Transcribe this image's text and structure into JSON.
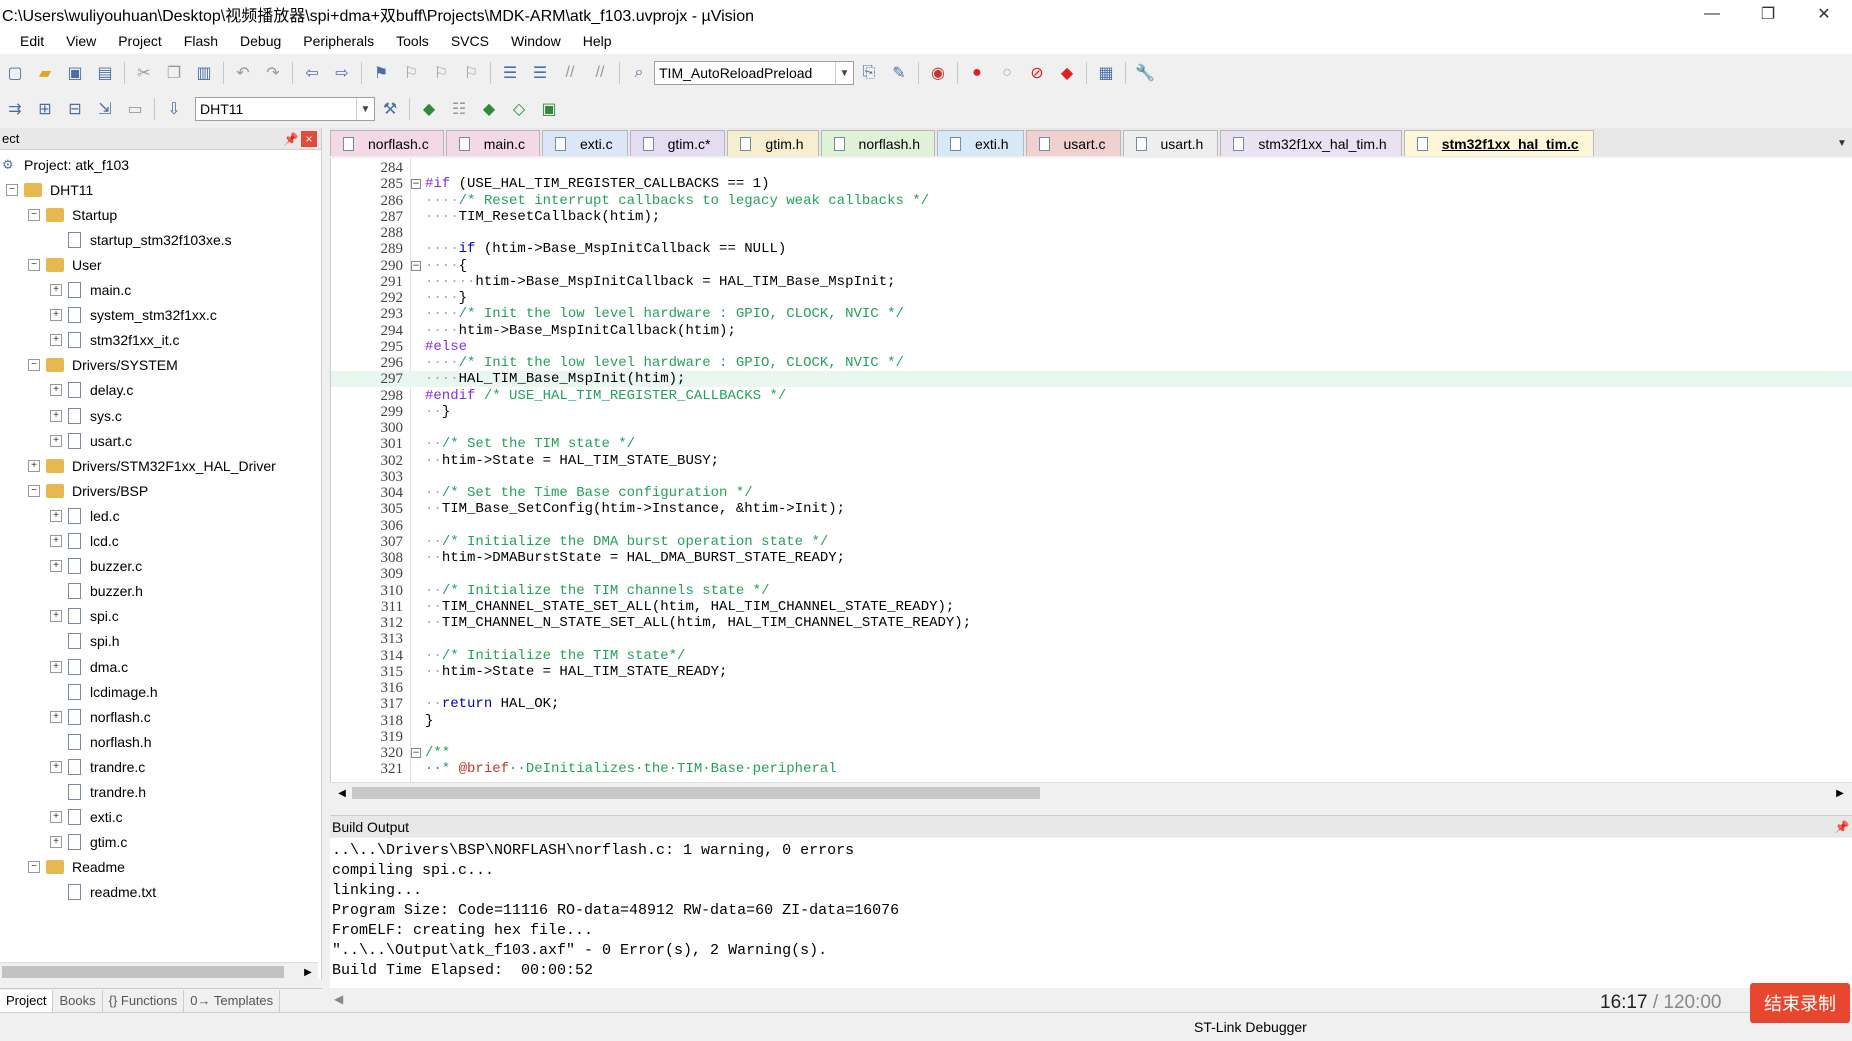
{
  "window": {
    "title": "C:\\Users\\wuliyouhuan\\Desktop\\视频播放器\\spi+dma+双buff\\Projects\\MDK-ARM\\atk_f103.uvprojx - µVision",
    "minimize": "—",
    "restore": "❐",
    "close": "✕"
  },
  "menu": [
    "Edit",
    "View",
    "Project",
    "Flash",
    "Debug",
    "Peripherals",
    "Tools",
    "SVCS",
    "Window",
    "Help"
  ],
  "toolbar": {
    "target_combo": "TIM_AutoReloadPreload",
    "build_target": "DHT11"
  },
  "project_panel": {
    "header": "ect",
    "pin": "📌",
    "close": "×",
    "root": "Project: atk_f103",
    "target": "DHT11",
    "groups": [
      {
        "name": "Startup",
        "files": [
          "startup_stm32f103xe.s"
        ]
      },
      {
        "name": "User",
        "files": [
          "main.c",
          "system_stm32f1xx.c",
          "stm32f1xx_it.c"
        ]
      },
      {
        "name": "Drivers/SYSTEM",
        "files": [
          "delay.c",
          "sys.c",
          "usart.c"
        ]
      },
      {
        "name": "Drivers/STM32F1xx_HAL_Driver",
        "files": []
      },
      {
        "name": "Drivers/BSP",
        "files": [
          "led.c",
          "lcd.c",
          "buzzer.c",
          "buzzer.h",
          "spi.c",
          "spi.h",
          "dma.c",
          "lcdimage.h",
          "norflash.c",
          "norflash.h",
          "trandre.c",
          "trandre.h",
          "exti.c",
          "gtim.c"
        ]
      },
      {
        "name": "Readme",
        "files": [
          "readme.txt"
        ]
      }
    ],
    "tabs": [
      "Project",
      "Books",
      "{} Functions",
      "0→ Templates"
    ]
  },
  "editor_tabs": [
    {
      "label": "norflash.c",
      "color": "#f3d9e6",
      "active": false
    },
    {
      "label": "main.c",
      "color": "#f3d9e6",
      "active": false
    },
    {
      "label": "exti.c",
      "color": "#dbe6f6",
      "active": false
    },
    {
      "label": "gtim.c*",
      "color": "#e6dcf2",
      "active": false
    },
    {
      "label": "gtim.h",
      "color": "#f6efcf",
      "active": false
    },
    {
      "label": "norflash.h",
      "color": "#dff2d8",
      "active": false
    },
    {
      "label": "exti.h",
      "color": "#d6e9f6",
      "active": false
    },
    {
      "label": "usart.c",
      "color": "#f1d0d0",
      "active": false
    },
    {
      "label": "usart.h",
      "color": "#eeeeee",
      "active": false
    },
    {
      "label": "stm32f1xx_hal_tim.h",
      "color": "#eae2f2",
      "active": false
    },
    {
      "label": "stm32f1xx_hal_tim.c",
      "color": "#fdf6d8",
      "active": true
    }
  ],
  "code_lines": [
    {
      "n": "284",
      "fold": "",
      "html": ""
    },
    {
      "n": "285",
      "fold": "−",
      "html": "<span class='pp'>#if</span> (USE_HAL_TIM_REGISTER_CALLBACKS == 1)"
    },
    {
      "n": "286",
      "fold": "",
      "html": "<span class='dot'>····</span><span class='cm'>/* Reset interrupt callbacks to legacy weak callbacks */</span>"
    },
    {
      "n": "287",
      "fold": "",
      "html": "<span class='dot'>····</span>TIM_ResetCallback(htim);"
    },
    {
      "n": "288",
      "fold": "",
      "html": ""
    },
    {
      "n": "289",
      "fold": "",
      "html": "<span class='dot'>····</span><span class='kw'>if</span> (htim->Base_MspInitCallback == NULL)"
    },
    {
      "n": "290",
      "fold": "−",
      "html": "<span class='dot'>····</span>{"
    },
    {
      "n": "291",
      "fold": "",
      "html": "<span class='dot'>······</span>htim->Base_MspInitCallback = HAL_TIM_Base_MspInit;"
    },
    {
      "n": "292",
      "fold": "",
      "html": "<span class='dot'>····</span>}"
    },
    {
      "n": "293",
      "fold": "",
      "html": "<span class='dot'>····</span><span class='cm'>/* Init the low level hardware : GPIO, CLOCK, NVIC */</span>"
    },
    {
      "n": "294",
      "fold": "",
      "html": "<span class='dot'>····</span>htim->Base_MspInitCallback(htim);"
    },
    {
      "n": "295",
      "fold": "",
      "html": "<span class='pp'>#else</span>"
    },
    {
      "n": "296",
      "fold": "",
      "html": "<span class='dot'>····</span><span class='cm'>/* Init the low level hardware : GPIO, CLOCK, NVIC */</span>"
    },
    {
      "n": "297",
      "fold": "",
      "html": "<span class='dot'>····</span>HAL_TIM_Base_MspInit(htim);",
      "hl": true
    },
    {
      "n": "298",
      "fold": "",
      "html": "<span class='pp'>#endif</span> <span class='cm'>/* USE_HAL_TIM_REGISTER_CALLBACKS */</span>"
    },
    {
      "n": "299",
      "fold": "",
      "html": "<span class='dot'>··</span>}"
    },
    {
      "n": "300",
      "fold": "",
      "html": ""
    },
    {
      "n": "301",
      "fold": "",
      "html": "<span class='dot'>··</span><span class='cm'>/* Set the TIM state */</span>"
    },
    {
      "n": "302",
      "fold": "",
      "html": "<span class='dot'>··</span>htim->State = HAL_TIM_STATE_BUSY;"
    },
    {
      "n": "303",
      "fold": "",
      "html": ""
    },
    {
      "n": "304",
      "fold": "",
      "html": "<span class='dot'>··</span><span class='cm'>/* Set the Time Base configuration */</span>"
    },
    {
      "n": "305",
      "fold": "",
      "html": "<span class='dot'>··</span>TIM_Base_SetConfig(htim->Instance, &amp;htim->Init);"
    },
    {
      "n": "306",
      "fold": "",
      "html": ""
    },
    {
      "n": "307",
      "fold": "",
      "html": "<span class='dot'>··</span><span class='cm'>/* Initialize the DMA burst operation state */</span>"
    },
    {
      "n": "308",
      "fold": "",
      "html": "<span class='dot'>··</span>htim->DMABurstState = HAL_DMA_BURST_STATE_READY;"
    },
    {
      "n": "309",
      "fold": "",
      "html": ""
    },
    {
      "n": "310",
      "fold": "",
      "html": "<span class='dot'>··</span><span class='cm'>/* Initialize the TIM channels state */</span>"
    },
    {
      "n": "311",
      "fold": "",
      "html": "<span class='dot'>··</span>TIM_CHANNEL_STATE_SET_ALL(htim, HAL_TIM_CHANNEL_STATE_READY);"
    },
    {
      "n": "312",
      "fold": "",
      "html": "<span class='dot'>··</span>TIM_CHANNEL_N_STATE_SET_ALL(htim, HAL_TIM_CHANNEL_STATE_READY);"
    },
    {
      "n": "313",
      "fold": "",
      "html": ""
    },
    {
      "n": "314",
      "fold": "",
      "html": "<span class='dot'>··</span><span class='cm'>/* Initialize the TIM state*/</span>"
    },
    {
      "n": "315",
      "fold": "",
      "html": "<span class='dot'>··</span>htim->State = HAL_TIM_STATE_READY;"
    },
    {
      "n": "316",
      "fold": "",
      "html": ""
    },
    {
      "n": "317",
      "fold": "",
      "html": "<span class='dot'>··</span><span class='kw'>return</span> HAL_OK;"
    },
    {
      "n": "318",
      "fold": "",
      "html": "}"
    },
    {
      "n": "319",
      "fold": "",
      "html": ""
    },
    {
      "n": "320",
      "fold": "−",
      "html": "<span class='cm'>/**</span>"
    },
    {
      "n": "321",
      "fold": "",
      "html": "<span class='cm'>··* <span style='color:#c0392b'>@brief</span>··DeInitializes·the·TIM·Base·peripheral</span>"
    }
  ],
  "build_output": {
    "title": "Build Output",
    "lines": [
      "..\\..\\Drivers\\BSP\\NORFLASH\\norflash.c: 1 warning, 0 errors",
      "compiling spi.c...",
      "linking...",
      "Program Size: Code=11116 RO-data=48912 RW-data=60 ZI-data=16076",
      "FromELF: creating hex file...",
      "\"..\\..\\Output\\atk_f103.axf\" - 0 Error(s), 2 Warning(s).",
      "Build Time Elapsed:  00:00:52"
    ]
  },
  "status": {
    "debugger": "ST-Link Debugger"
  },
  "recorder": {
    "elapsed": "16:17",
    "total": "/ 120:00",
    "stop_label": "结束录制"
  }
}
